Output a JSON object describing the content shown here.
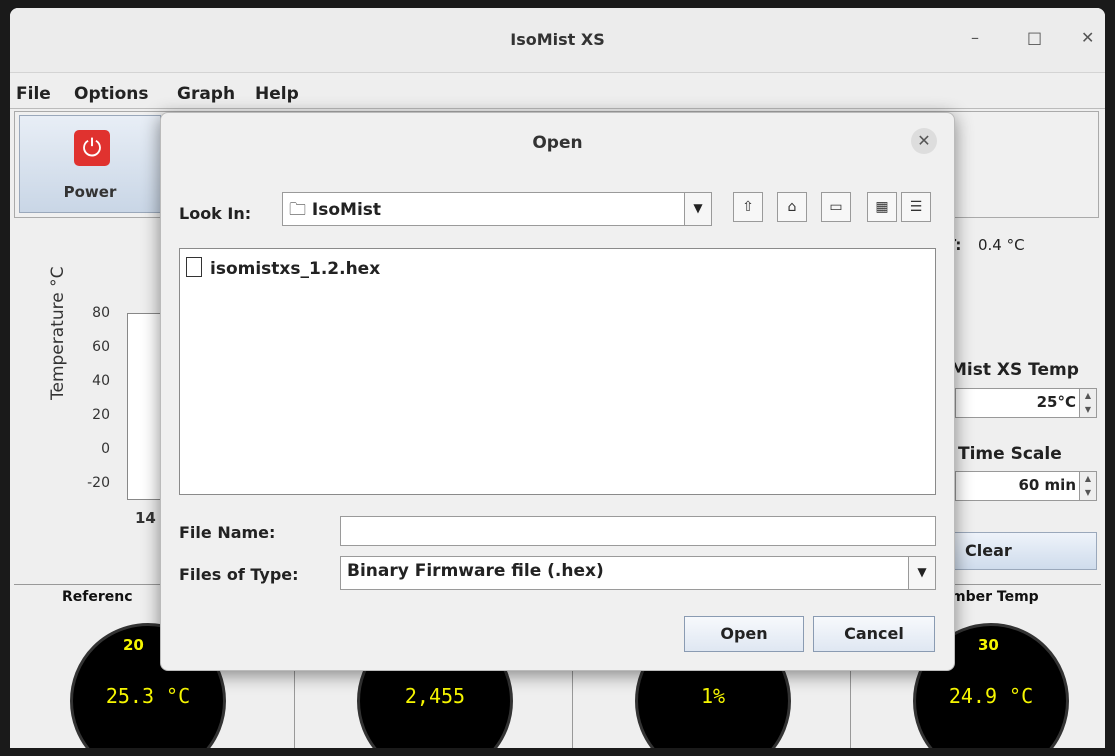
{
  "window": {
    "title": "IsoMist XS",
    "minimize": "–",
    "maximize": "□",
    "close": "✕"
  },
  "menu": [
    "File",
    "Options",
    "Graph",
    "Help"
  ],
  "toolbar": {
    "power_label": "Power",
    "power_icon": "⏻"
  },
  "chart": {
    "ylabel": "Temperature °C",
    "yticks": [
      "80",
      "60",
      "40",
      "20",
      "0",
      "-20"
    ],
    "xtick_first": "14"
  },
  "right_panel": {
    "dt_label": "T:",
    "dt_value": "0.4 °C",
    "setpoint_label": "Mist XS Temp",
    "setpoint_value": "25°C",
    "timescale_label": "Time Scale",
    "timescale_value": "60 min",
    "clear_label": "Clear"
  },
  "gauges": [
    {
      "title": "Referenc",
      "value": "25.3 °C",
      "tick": "20"
    },
    {
      "title": "",
      "value": "2,455",
      "tick": ""
    },
    {
      "title": "",
      "value": "1%",
      "tick": ""
    },
    {
      "title": "mber Temp",
      "value": "24.9 °C",
      "tick": "30"
    }
  ],
  "dialog": {
    "title": "Open",
    "close_glyph": "✕",
    "look_in_label": "Look In:",
    "look_in_value": "IsoMist",
    "toolbar_icons": [
      "up-folder-icon",
      "home-icon",
      "new-folder-icon",
      "list-view-icon",
      "details-view-icon"
    ],
    "files": [
      "isomistxs_1.2.hex"
    ],
    "file_name_label": "File Name:",
    "file_name_value": "",
    "files_of_type_label": "Files of Type:",
    "files_of_type_value": "Binary Firmware file (.hex)",
    "open_button": "Open",
    "cancel_button": "Cancel"
  }
}
